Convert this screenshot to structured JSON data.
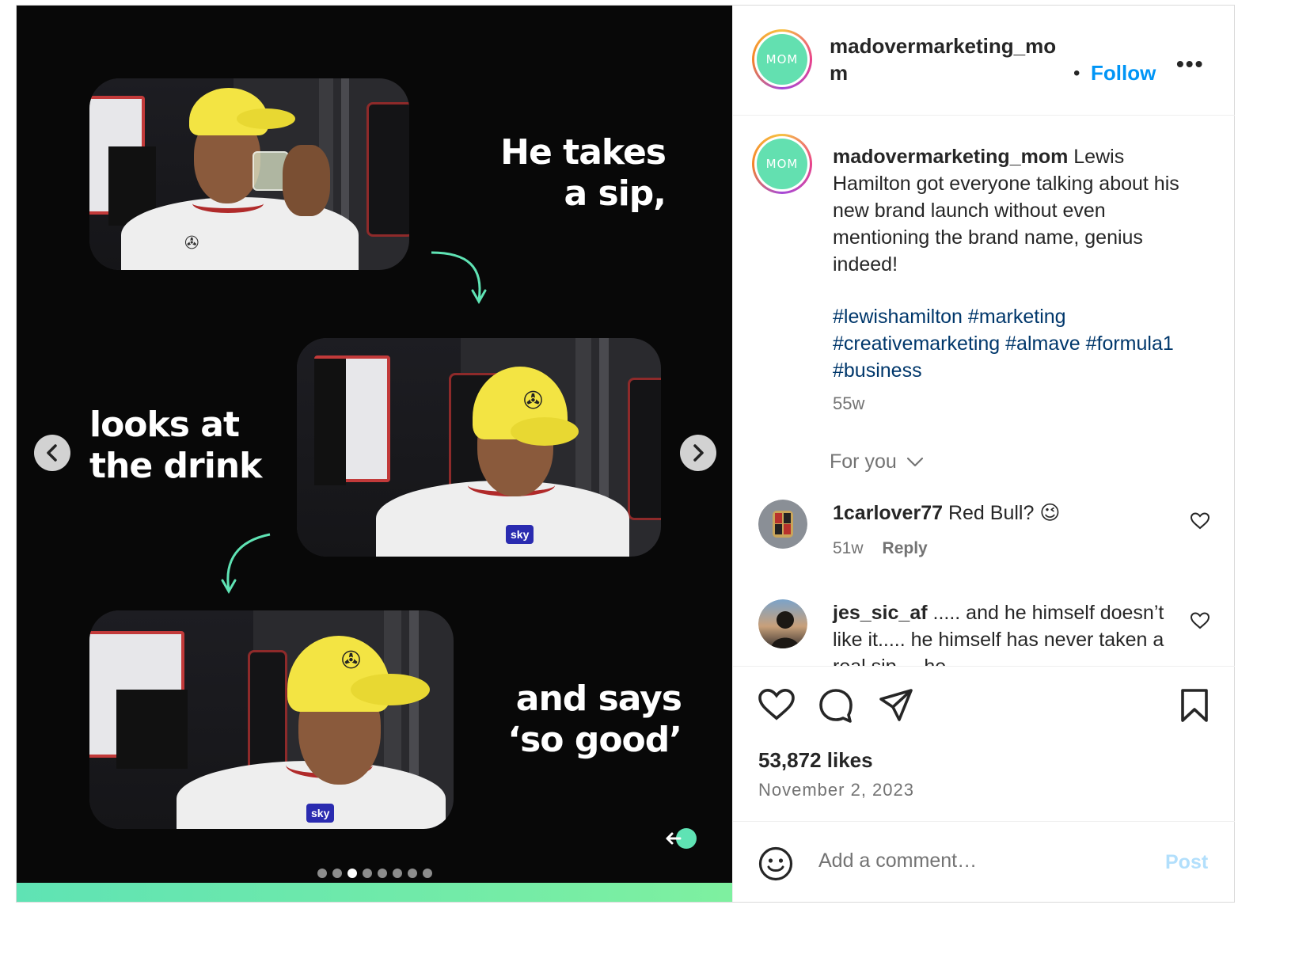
{
  "media": {
    "captions": {
      "first": "He takes a sip,",
      "second": "looks at the drink",
      "third": "and says ‘so good’"
    },
    "carousel": {
      "total_slides": 8,
      "active_index": 2
    },
    "accent_color": "#5fe3b4"
  },
  "header": {
    "username": "madovermarketing_mom",
    "avatar_text": "MOM",
    "follow_label": "Follow",
    "more_label": "•••"
  },
  "post": {
    "author": "madovermarketing_mom",
    "caption": "Lewis Hamilton got everyone talking about his new brand launch without even mentioning the brand name, genius indeed!",
    "hashtags": "#lewishamilton #marketing #creativemarketing #almave #formula1 #business",
    "age": "55w"
  },
  "comments_filter": {
    "label": "For you"
  },
  "comments": [
    {
      "username": "1carlover77",
      "text": "Red Bull? 😉",
      "age": "51w",
      "reply_label": "Reply"
    },
    {
      "username": "jes_sic_af",
      "text": "..... and he himself doesn’t like it..... he himself has never taken a real sip.... he",
      "age": "",
      "reply_label": ""
    }
  ],
  "engagement": {
    "likes": "53,872 likes",
    "date": "November 2, 2023"
  },
  "composer": {
    "placeholder": "Add a comment…",
    "post_label": "Post"
  },
  "icons": [
    "chevron-left-icon",
    "chevron-right-icon",
    "heart-icon",
    "comment-icon",
    "share-icon",
    "bookmark-icon",
    "emoji-icon",
    "more-icon",
    "chevron-down-icon"
  ]
}
